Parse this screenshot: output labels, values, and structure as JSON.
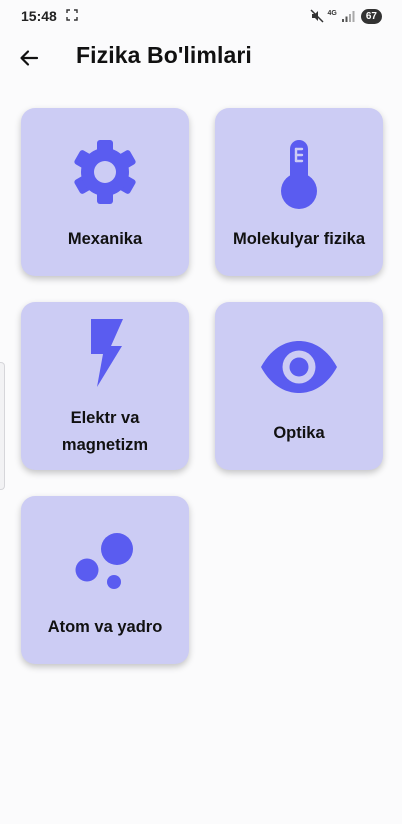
{
  "status_bar": {
    "time": "15:48",
    "network": "4G",
    "battery": "67"
  },
  "app_bar": {
    "title": "Fizika Bo'limlari",
    "back_icon": "arrow-left-icon"
  },
  "colors": {
    "card_bg": "#ccccf4",
    "icon": "#5a5cf0",
    "background": "#fbfbfc"
  },
  "sections": [
    {
      "label": "Mexanika",
      "icon": "gear-icon"
    },
    {
      "label": "Molekulyar fizika",
      "icon": "thermometer-icon"
    },
    {
      "label": "Elektr va\nmagnetizm",
      "icon": "lightning-icon"
    },
    {
      "label": "Optika",
      "icon": "eye-icon"
    },
    {
      "label": "Atom va yadro",
      "icon": "atom-bubbles-icon"
    }
  ]
}
